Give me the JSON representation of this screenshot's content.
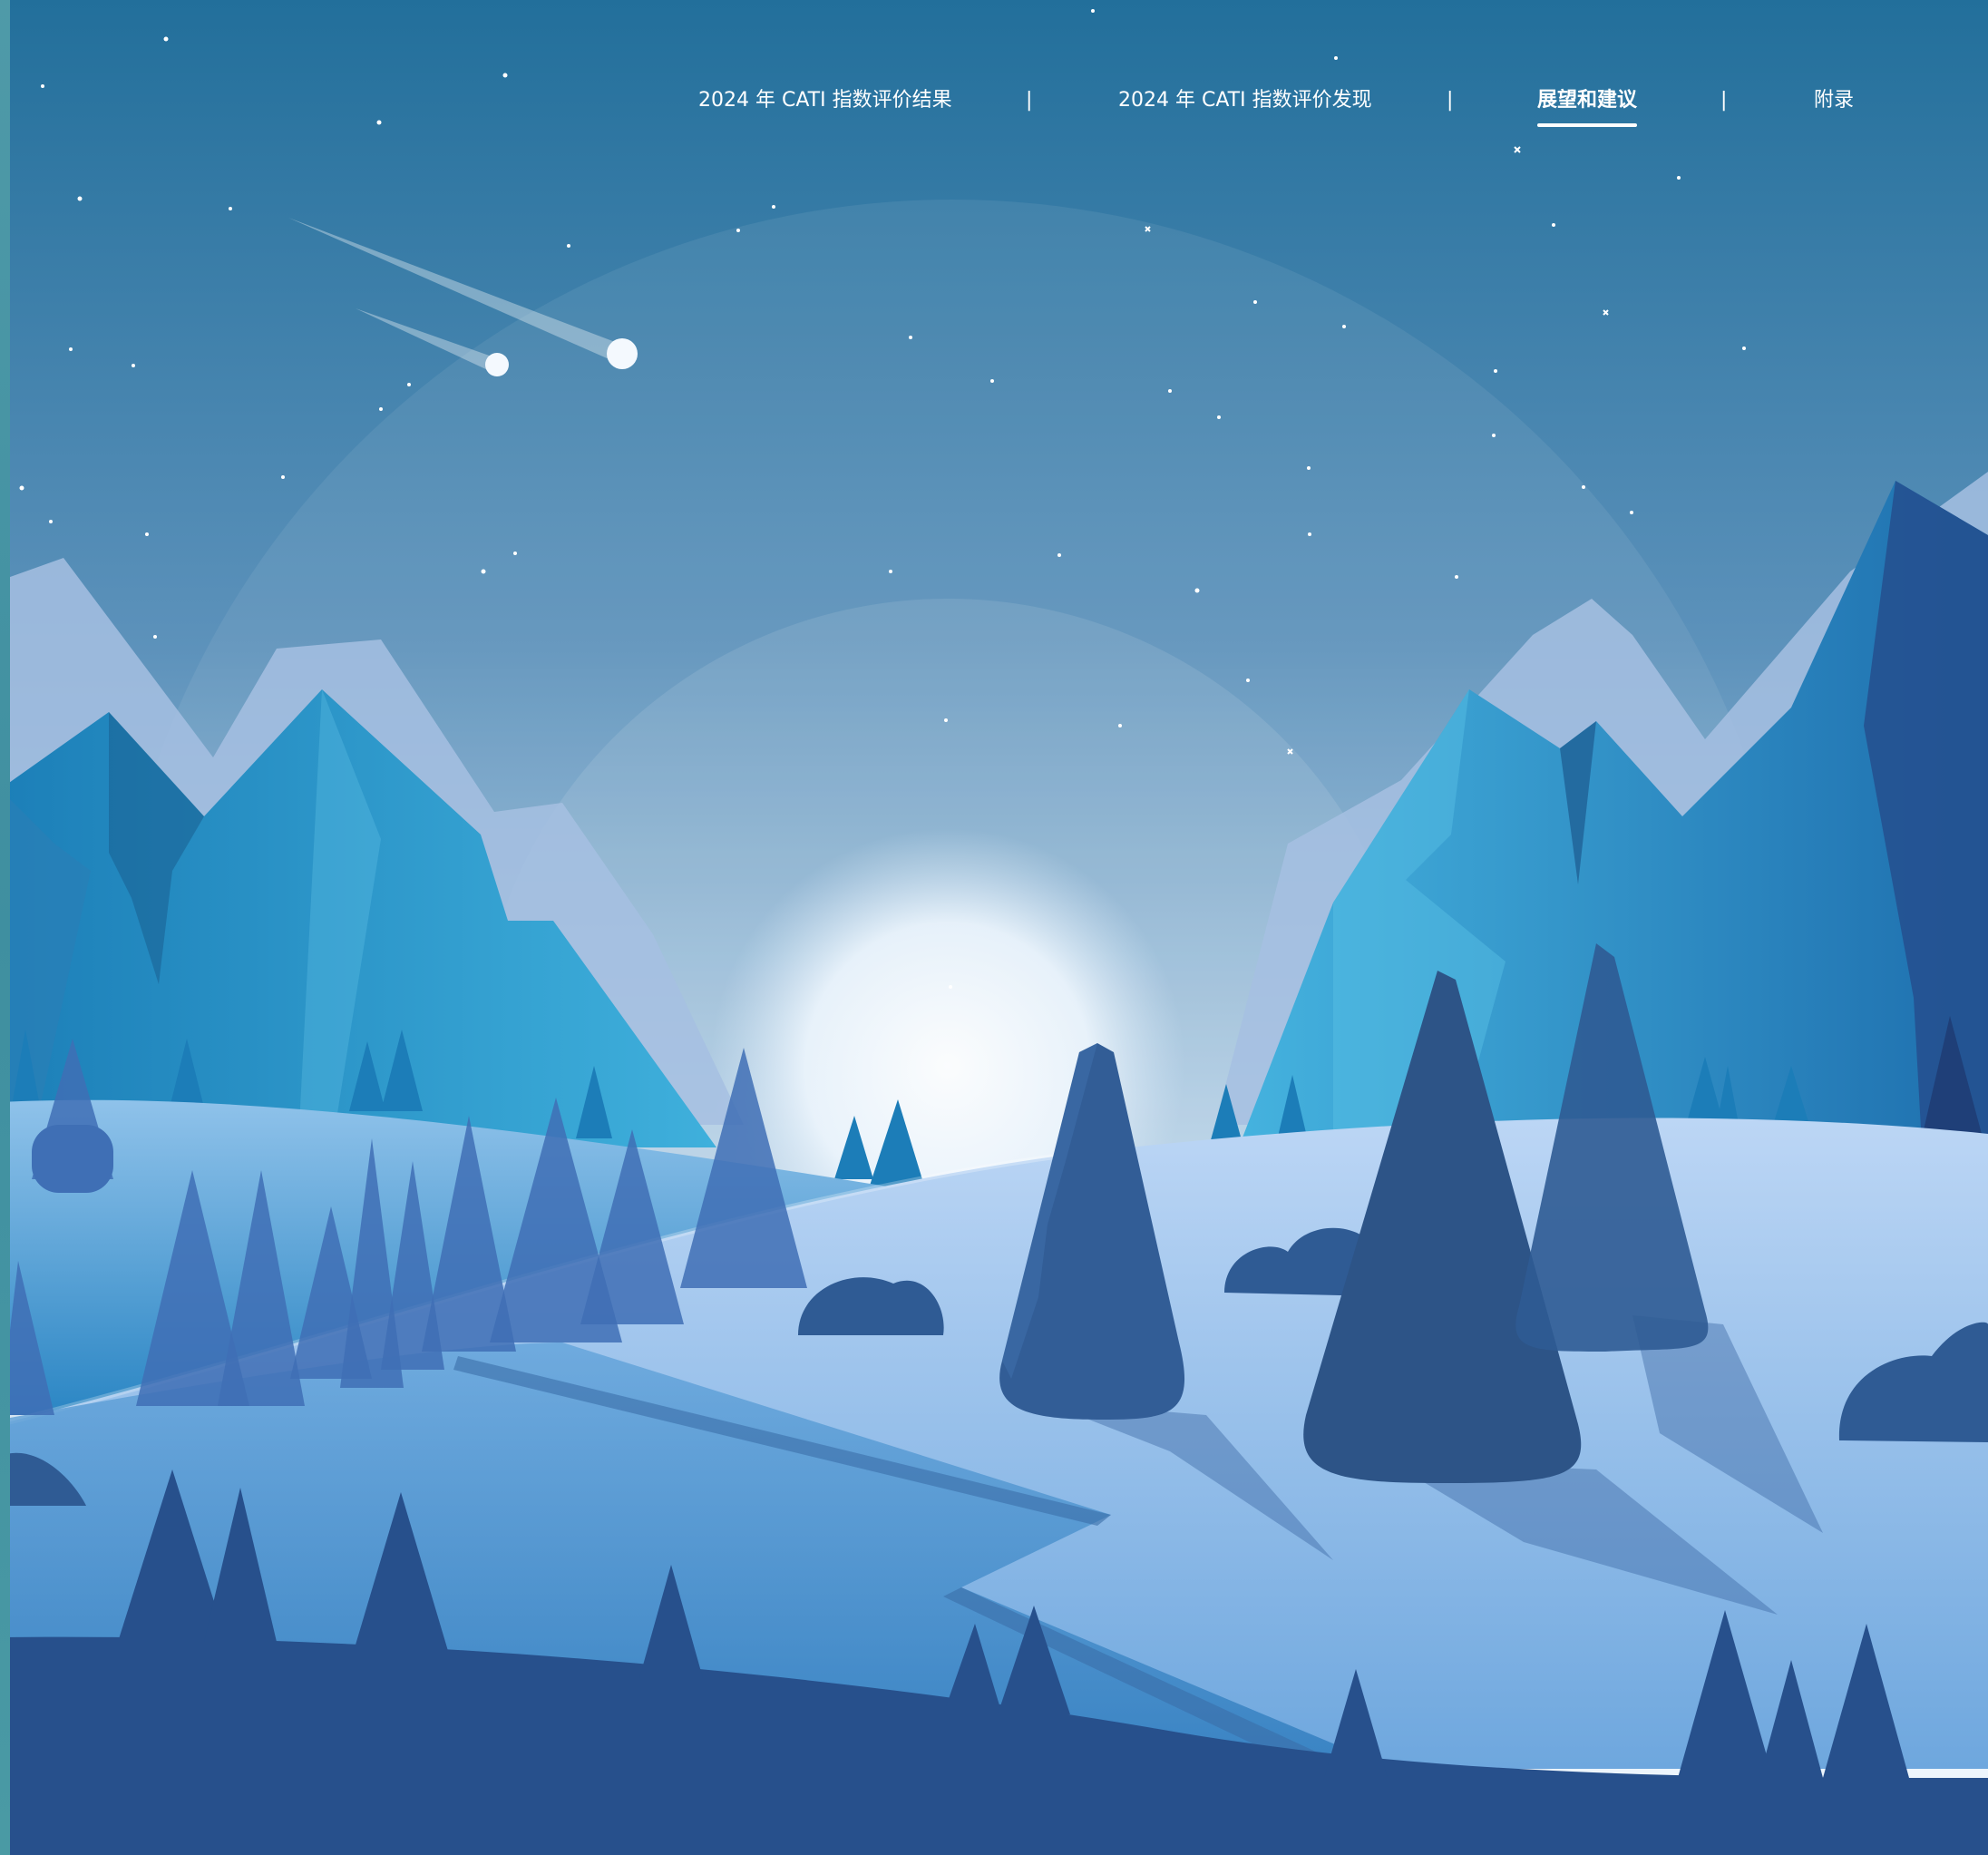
{
  "nav": {
    "items": [
      {
        "label": "2024 年 CATI 指数评价结果",
        "active": false
      },
      {
        "label": "2024 年 CATI 指数评价发现",
        "active": false
      },
      {
        "label": "展望和建议",
        "active": true
      },
      {
        "label": "附录",
        "active": false
      }
    ],
    "separator": "|"
  },
  "scene": {
    "sky_top": "#226f9b",
    "sky_mid": "#7aaac9",
    "sky_bottom": "#e8f2fb",
    "moon": "#f4f9fe",
    "mountain_blue": "#2f9bd0",
    "mountain_dark": "#24508f",
    "tree": "#2f5b94",
    "snow": "#a9c9ef",
    "foreground": "#27508c"
  }
}
